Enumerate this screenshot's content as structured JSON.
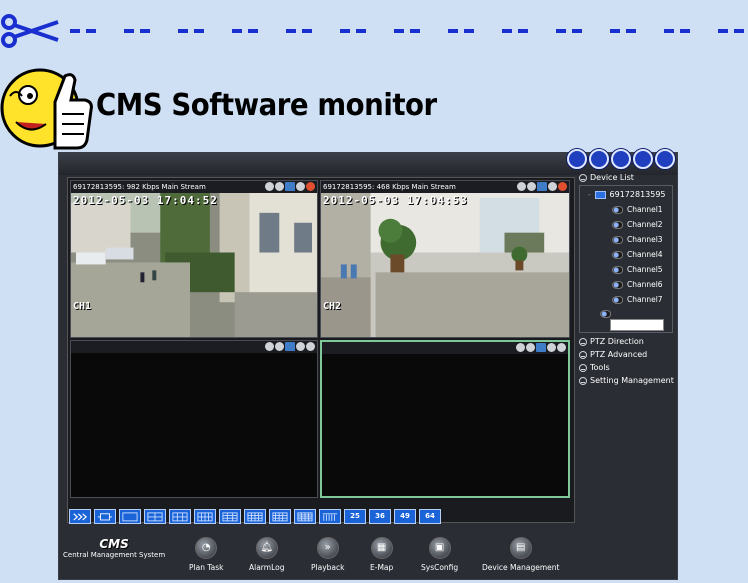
{
  "banner": {
    "title": "CMS Software monitor",
    "icons": [
      "scissors-icon",
      "thumbs-up-smiley-icon"
    ]
  },
  "app": {
    "accent_color": "#1a64d8",
    "video_cells": [
      {
        "header": "69172813595: 982 Kbps Main Stream",
        "timestamp": "2012-05-03  17:04:52",
        "channel_label": "CH1"
      },
      {
        "header": "69172813595: 468 Kbps Main Stream",
        "timestamp": "2012-05-03  17:04:53",
        "channel_label": "CH2"
      },
      {
        "header": ""
      },
      {
        "header": ""
      }
    ],
    "layout_buttons": [
      "25",
      "36",
      "49",
      "64"
    ],
    "sidebar": {
      "device_list_label": "Device List",
      "device": "69172813595",
      "channels": [
        "Channel1",
        "Channel2",
        "Channel3",
        "Channel4",
        "Channel5",
        "Channel6",
        "Channel7"
      ],
      "sections": [
        "PTZ Direction",
        "PTZ Advanced",
        "Tools",
        "Setting Management"
      ]
    },
    "logo": {
      "big": "CMS",
      "small": "Central Management System"
    },
    "toolbar": [
      "Plan Task",
      "AlarmLog",
      "Playback",
      "E-Map",
      "SysConfig",
      "Device Management"
    ]
  }
}
